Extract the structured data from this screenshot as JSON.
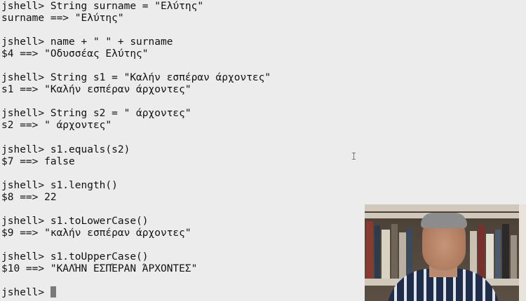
{
  "terminal": {
    "lines": [
      "jshell> String surname = \"Ελύτης\"",
      "surname ==> \"Ελύτης\"",
      "",
      "jshell> name + \" \" + surname",
      "$4 ==> \"Οδυσσέας Ελύτης\"",
      "",
      "jshell> String s1 = \"Καλήν εσπέραν άρχοντες\"",
      "s1 ==> \"Καλήν εσπέραν άρχοντες\"",
      "",
      "jshell> String s2 = \" άρχοντες\"",
      "s2 ==> \" άρχοντες\"",
      "",
      "jshell> s1.equals(s2)",
      "$7 ==> false",
      "",
      "jshell> s1.length()",
      "$8 ==> 22",
      "",
      "jshell> s1.toLowerCase()",
      "$9 ==> \"καλήν εσπέραν άρχοντες\"",
      "",
      "jshell> s1.toUpperCase()",
      "$10 ==> \"ΚΑΛΉΝ ΕΣΠΈΡΑΝ ΆΡΧΟΝΤΕΣ\"",
      ""
    ],
    "prompt": "jshell> "
  },
  "colors": {
    "background": "#ececec",
    "text": "#111111",
    "cursor": "#7a7a7a"
  }
}
